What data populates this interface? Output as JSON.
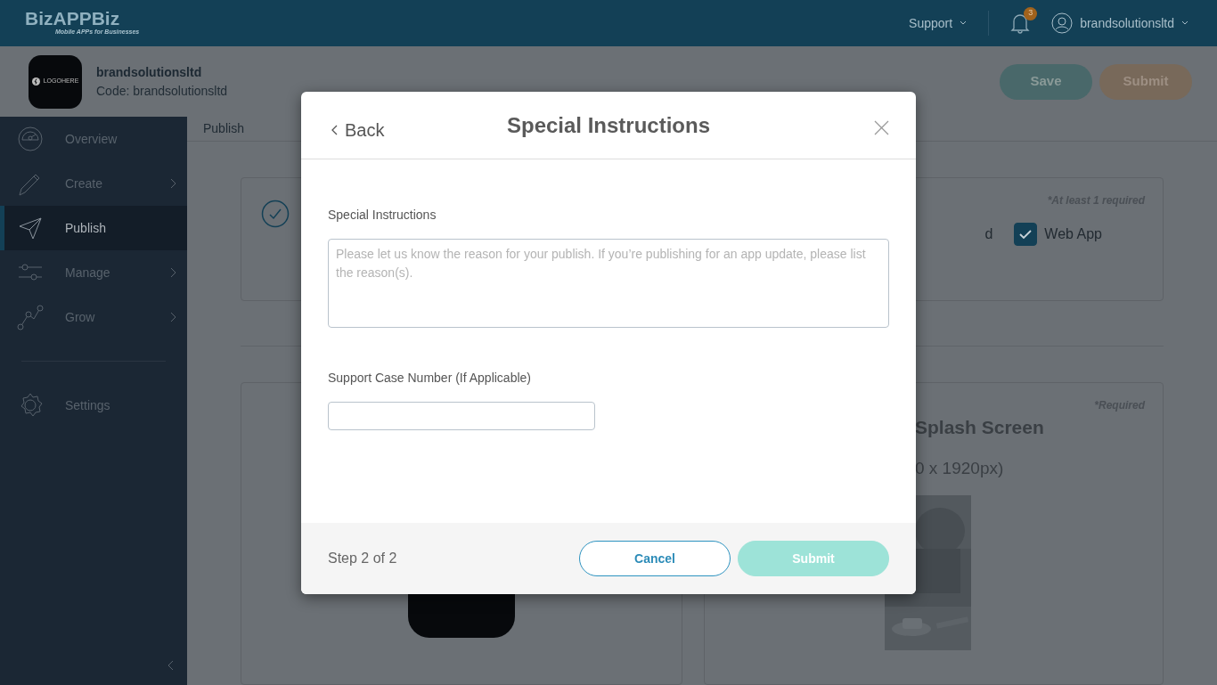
{
  "topbar": {
    "logo": "BizAPPBiz",
    "tagline": "Mobile APPs for Businesses",
    "support": "Support",
    "notifications": "3",
    "user": "brandsolutionsltd"
  },
  "app": {
    "logo_text": "LOGOHERE",
    "name": "brandsolutionsltd",
    "code": "Code: brandsolutionsltd"
  },
  "header_buttons": [
    {
      "label": "Save",
      "kind": "save"
    },
    {
      "label": "Submit",
      "kind": "submit"
    }
  ],
  "sidebar": {
    "items": [
      {
        "label": "Overview",
        "selected": false,
        "expandable": false
      },
      {
        "label": "Create",
        "selected": false,
        "expandable": true
      },
      {
        "label": "Publish",
        "selected": true,
        "expandable": false
      },
      {
        "label": "Manage",
        "selected": false,
        "expandable": true
      },
      {
        "label": "Grow",
        "selected": false,
        "expandable": true
      },
      {
        "label": "Settings",
        "selected": false,
        "expandable": false
      }
    ]
  },
  "breadcrumb": "Publish",
  "platform_card": {
    "note": "*At least 1 required",
    "label_fragment": "d",
    "platforms": [
      {
        "label": "Web App",
        "checked": true
      }
    ]
  },
  "splash_card": {
    "note": "*Required",
    "title": "Splash Screen",
    "size": "0 x 1920px)"
  },
  "modal": {
    "back": "Back",
    "title": "Special Instructions",
    "fields": [
      {
        "kind": "textarea",
        "label": "Special Instructions",
        "placeholder": "Please let us know the reason for your publish. If you’re publishing for an app update, please list the reason(s)."
      },
      {
        "kind": "input",
        "label": "Support Case Number (If Applicable)"
      }
    ],
    "step": "Step 2 of 2",
    "buttons": [
      {
        "label": "Cancel",
        "kind": "outline"
      },
      {
        "label": "Submit",
        "kind": "primary",
        "disabled": true
      }
    ]
  }
}
